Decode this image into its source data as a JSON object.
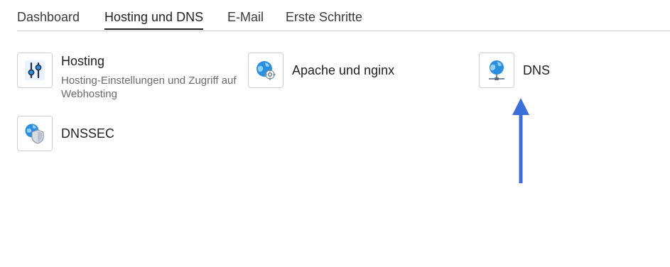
{
  "tabs": [
    {
      "label": "Dashboard",
      "active": false
    },
    {
      "label": "Hosting und DNS",
      "active": true
    },
    {
      "label": "E-Mail",
      "active": false
    },
    {
      "label": "Erste Schritte",
      "active": false
    }
  ],
  "tiles": [
    {
      "title": "Hosting",
      "description": "Hosting-Einstellungen und Zugriff auf Webhosting",
      "icon": "sliders-icon"
    },
    {
      "title": "Apache und nginx",
      "icon": "globe-gear-icon"
    },
    {
      "title": "DNS",
      "icon": "dns-globe-icon"
    },
    {
      "title": "DNSSEC",
      "icon": "globe-shield-icon"
    }
  ],
  "annotation": {
    "arrow_color": "#3b6fd9",
    "points_to": "DNS"
  },
  "colors": {
    "accent": "#3b6fd9",
    "tab_underline": "#222222",
    "border": "#d0d0d0"
  }
}
